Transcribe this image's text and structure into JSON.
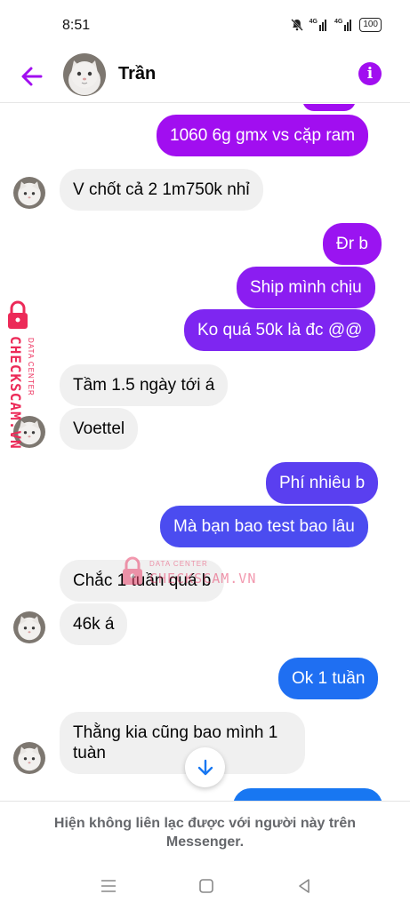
{
  "status_bar": {
    "time": "8:51",
    "network_1": "4G",
    "network_2": "4G",
    "battery": "100"
  },
  "header": {
    "contact_name": "Trần",
    "back_icon": "arrow-left-icon",
    "info_icon": "info-icon"
  },
  "messages": [
    {
      "sender": "me",
      "text": "1060 6g gmx vs cặp ram",
      "color": "#a10ef0"
    },
    {
      "sender": "contact",
      "text": "V chốt cả 2 1m750k nhỉ"
    },
    {
      "sender": "me",
      "text": "Đr b",
      "color": "#9a14f1"
    },
    {
      "sender": "me",
      "text": "Ship mình chịu",
      "color": "#8b1df1"
    },
    {
      "sender": "me",
      "text": "Ko quá 50k là đc @@",
      "color": "#7e26f1"
    },
    {
      "sender": "contact",
      "text": "Tầm 1.5 ngày tới á"
    },
    {
      "sender": "contact",
      "text": "Voettel"
    },
    {
      "sender": "me",
      "text": "Phí nhiêu b",
      "color": "#5a3ff0"
    },
    {
      "sender": "me",
      "text": "Mà bạn bao test bao lâu",
      "color": "#4b4cf0"
    },
    {
      "sender": "contact",
      "text": "Chắc 1 tuần quá b"
    },
    {
      "sender": "contact",
      "text": "46k á"
    },
    {
      "sender": "me",
      "text": "Ok 1 tuần",
      "color": "#1f6ff2"
    },
    {
      "sender": "contact",
      "text": "Thằng kia cũng bao mình 1 tuàn"
    }
  ],
  "watermark": {
    "label": "DATA CENTER",
    "site": "CHECKSCAM.VN",
    "color": "#e8456d"
  },
  "footer": {
    "notice": "Hiện không liên lạc được với người này trên Messenger."
  },
  "navbar": {
    "menu_icon": "menu-icon",
    "home_icon": "home-square-icon",
    "back_icon": "back-triangle-icon"
  },
  "colors": {
    "accent": "#a10ef0",
    "incoming_bubble": "#f0f0f0"
  }
}
